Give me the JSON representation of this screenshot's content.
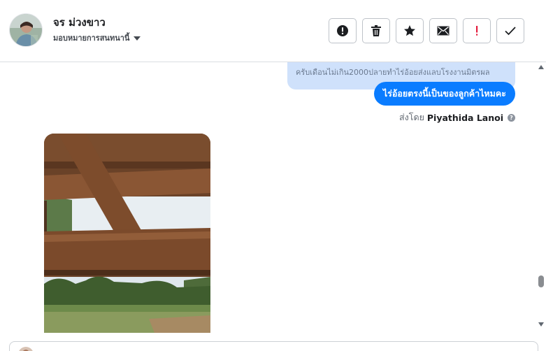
{
  "header": {
    "contact_name": "จร ม่วงขาว",
    "assign_label": "มอบหมายการสนทนานี้",
    "actions": [
      {
        "name": "spam-button",
        "icon": "alert-circle-icon"
      },
      {
        "name": "delete-button",
        "icon": "trash-icon"
      },
      {
        "name": "star-button",
        "icon": "star-icon"
      },
      {
        "name": "mark-unread-button",
        "icon": "envelope-icon"
      },
      {
        "name": "follow-up-button",
        "icon": "exclamation-icon"
      },
      {
        "name": "mark-done-button",
        "icon": "checkmark-icon"
      }
    ]
  },
  "thread": {
    "quoted_text": "ครับเดือนไม่เกิน2000ปลายทำไร่อ้อยส่งแลบโรงงานมิตรผล",
    "message_text": "ไร่อ้อยตรงนี้เป็นของลูกค้าไหมคะ",
    "sent_by_prefix": "ส่งโดย",
    "sent_by_name": "Piyathida Lanoi",
    "info_glyph": "?"
  },
  "colors": {
    "bubble_blue": "#0a7cff",
    "quoted_bg": "#cfe1fb",
    "follow_up_red": "#e41e3f"
  }
}
